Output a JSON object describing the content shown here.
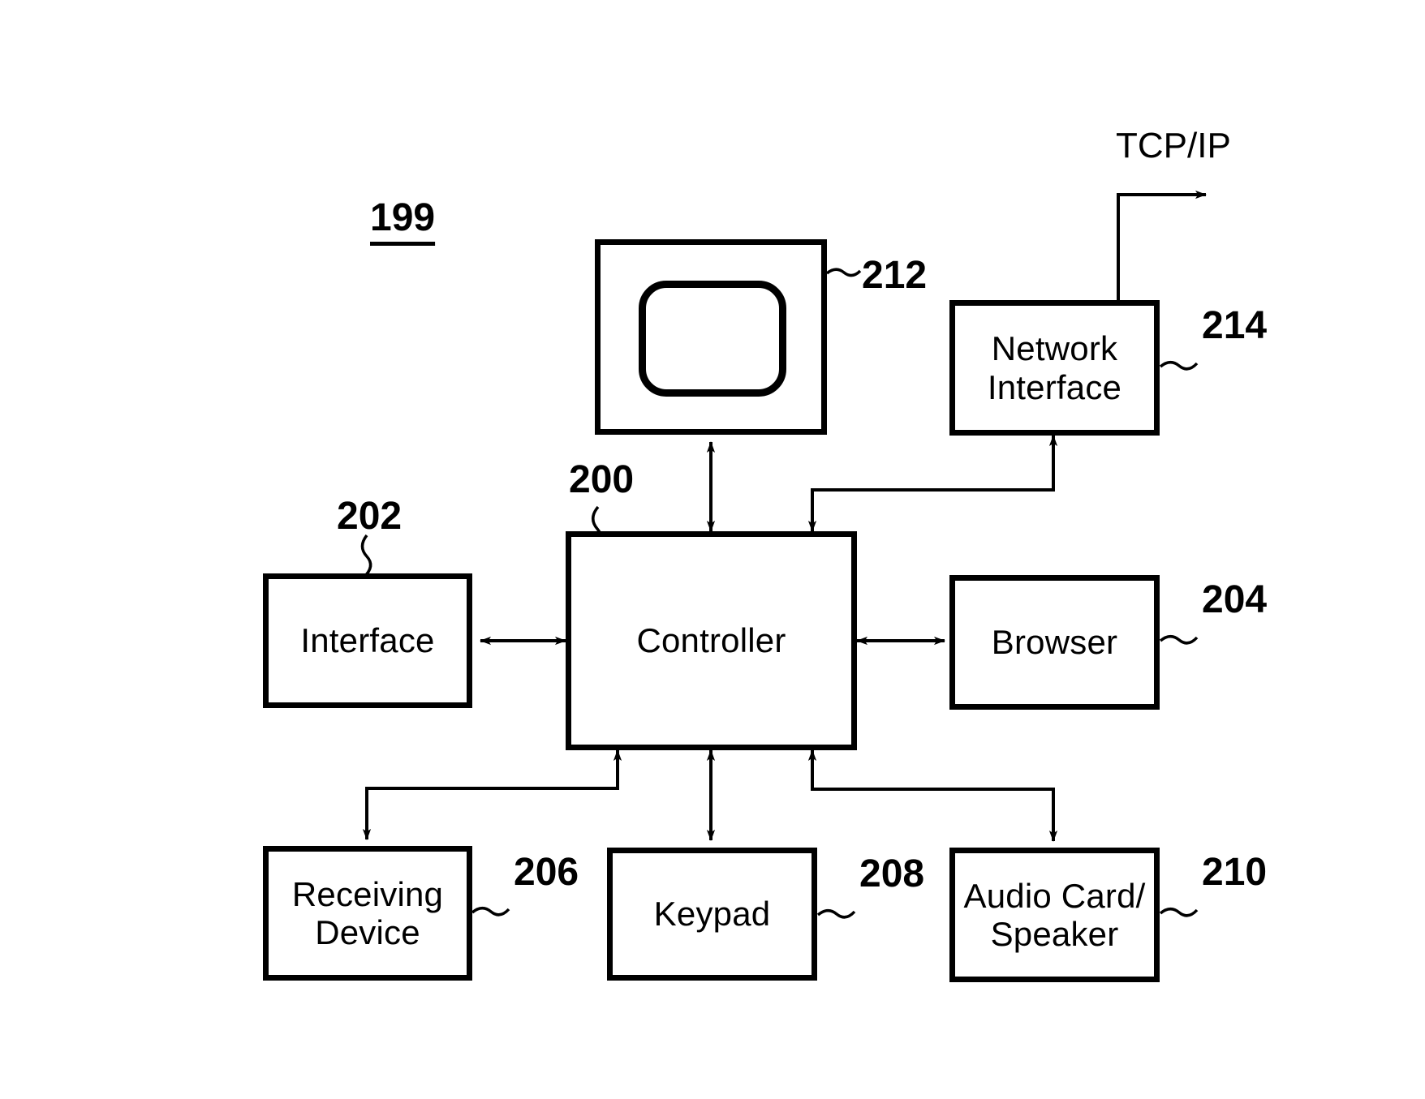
{
  "figure": {
    "figure_number": "199",
    "protocol_label": "TCP/IP"
  },
  "nodes": [
    {
      "id": "display",
      "label": "",
      "ref": "212"
    },
    {
      "id": "network-interface",
      "label": "Network\nInterface",
      "ref": "214"
    },
    {
      "id": "interface",
      "label": "Interface",
      "ref": "202"
    },
    {
      "id": "controller",
      "label": "Controller",
      "ref": "200"
    },
    {
      "id": "browser",
      "label": "Browser",
      "ref": "204"
    },
    {
      "id": "receiving-device",
      "label": "Receiving\nDevice",
      "ref": "206"
    },
    {
      "id": "keypad",
      "label": "Keypad",
      "ref": "208"
    },
    {
      "id": "audio-card",
      "label": "Audio Card/\nSpeaker",
      "ref": "210"
    }
  ],
  "connections": [
    {
      "from": "controller",
      "to": "display",
      "direction": "bidirectional"
    },
    {
      "from": "controller",
      "to": "network-interface",
      "direction": "to"
    },
    {
      "from": "network-interface",
      "to": "controller",
      "direction": "to"
    },
    {
      "from": "interface",
      "to": "controller",
      "direction": "bidirectional"
    },
    {
      "from": "controller",
      "to": "browser",
      "direction": "bidirectional"
    },
    {
      "from": "controller",
      "to": "receiving-device",
      "direction": "to"
    },
    {
      "from": "receiving-device",
      "to": "controller",
      "direction": "to"
    },
    {
      "from": "controller",
      "to": "keypad",
      "direction": "bidirectional"
    },
    {
      "from": "controller",
      "to": "audio-card",
      "direction": "to"
    },
    {
      "from": "audio-card",
      "to": "controller",
      "direction": "to"
    },
    {
      "from": "network-interface",
      "to": "tcp-ip",
      "direction": "to"
    }
  ],
  "colors": {
    "stroke": "#000000",
    "background": "#ffffff"
  }
}
